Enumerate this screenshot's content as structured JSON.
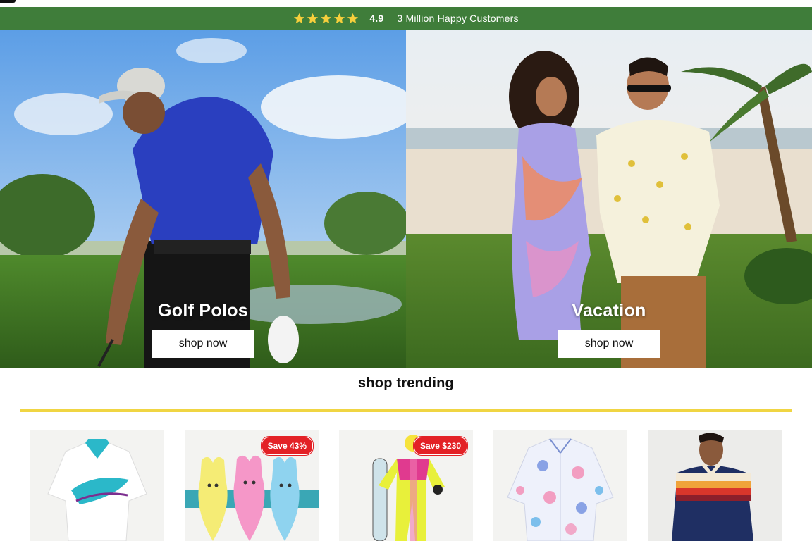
{
  "promo": {
    "star_count": 5,
    "star_color": "#f6cf3c",
    "rating": "4.9",
    "customers": "3 Million Happy Customers",
    "bar_color": "#3f7d3a"
  },
  "heroes": [
    {
      "title": "Golf Polos",
      "button": "shop now"
    },
    {
      "title": "Vacation",
      "button": "shop now"
    }
  ],
  "trending": {
    "title": "shop trending",
    "rule_color": "#f0d543",
    "products": [
      {
        "image": "white-teal-polo",
        "badge": ""
      },
      {
        "image": "peeps-plush",
        "badge": "Save 43%"
      },
      {
        "image": "neon-ski-suit",
        "badge": "Save $230"
      },
      {
        "image": "floral-button-shirt",
        "badge": ""
      },
      {
        "image": "striped-polo-model",
        "badge": ""
      }
    ]
  }
}
